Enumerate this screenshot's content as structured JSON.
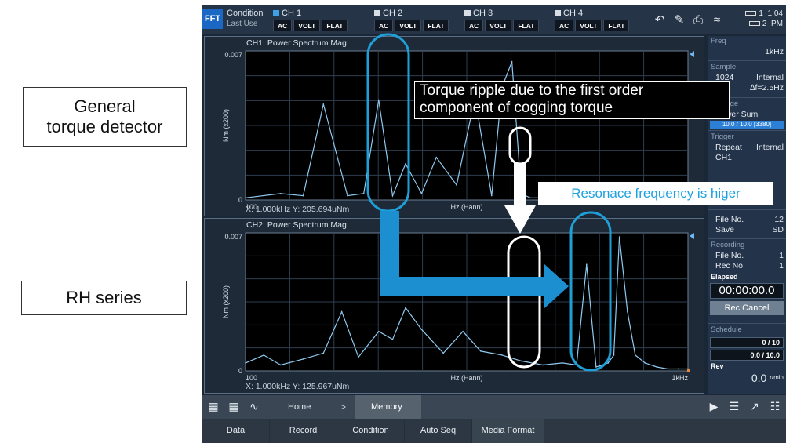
{
  "annotations": {
    "general_line1": "General",
    "general_line2": "torque detector",
    "rh_series": "RH series",
    "torque_line1": "Torque ripple due to the first order",
    "torque_line2": "component of cogging torque",
    "resonance": "Resonace frequency is higer"
  },
  "topbar": {
    "mode_badge": "FFT",
    "condition": "Condition",
    "last_use": "Last Use",
    "channels": [
      {
        "name": "CH 1",
        "coupling": "AC",
        "unit": "VOLT",
        "filter": "FLAT",
        "active": true
      },
      {
        "name": "CH 2",
        "coupling": "AC",
        "unit": "VOLT",
        "filter": "FLAT",
        "active": false
      },
      {
        "name": "CH 3",
        "coupling": "AC",
        "unit": "VOLT",
        "filter": "FLAT",
        "active": false
      },
      {
        "name": "CH 4",
        "coupling": "AC",
        "unit": "VOLT",
        "filter": "FLAT",
        "active": false
      }
    ],
    "battery1": "1",
    "battery2": "2",
    "time": "1:04",
    "ampm": "PM"
  },
  "right_panel": {
    "freq_head": "Freq",
    "freq_value": "1kHz",
    "sample_head": "Sample",
    "sample_count": "1024",
    "sample_src": "Internal",
    "sample_df": "∆f=2.5Hz",
    "average_head": "Average",
    "average_mode": "Power Sum",
    "average_progress": "10.0 / 10.0 [3380]",
    "trigger_head": "Trigger",
    "trigger_mode": "Repeat",
    "trigger_src": "Internal",
    "trigger_ch": "CH1",
    "file_label": "File No.",
    "file_value": "12",
    "save_label": "Save",
    "save_value": "SD",
    "recording_head": "Recording",
    "rec_file_label": "File No.",
    "rec_file_value": "1",
    "rec_no_label": "Rec No.",
    "rec_no_value": "1",
    "elapsed_label": "Elapsed",
    "elapsed_value": "00:00:00.0",
    "rec_cancel": "Rec Cancel",
    "schedule_head": "Schedule",
    "schedule_count": "0 / 10",
    "schedule_time": "0.0 / 10.0",
    "rev_label": "Rev",
    "rev_value": "0.0",
    "rev_unit": "r/min"
  },
  "nav": {
    "home": "Home",
    "chevron": ">",
    "memory": "Memory"
  },
  "function_bar": [
    "Data",
    "Record",
    "Condition",
    "Auto Seq",
    "Media Format"
  ],
  "colors": {
    "trace": "#8fc9f0",
    "circle_blue": "#1f9fd8",
    "circle_white": "#ffffff",
    "arrow_blue": "#1c8fd1",
    "plot_bg": "#000000",
    "grid": "#2e3e50"
  },
  "chart_data": [
    {
      "type": "line",
      "title": "CH1: Power Spectrum Mag",
      "xlabel": "Hz (Hann)",
      "ylabel": "Nm (x200)",
      "xlim_labels": [
        "100",
        ""
      ],
      "y_top_label": "0.007",
      "y_bottom_label": "0",
      "x_scale": "log",
      "xlim": [
        100,
        1000
      ],
      "ylim": [
        0,
        0.007
      ],
      "readout": "X: 1.000kHz Y: 205.694uNm",
      "x": [
        100,
        120,
        135,
        150,
        170,
        185,
        200,
        215,
        230,
        250,
        270,
        300,
        330,
        360,
        380,
        400,
        420,
        440,
        480,
        520,
        560,
        600,
        620,
        640,
        700,
        750,
        800,
        850,
        900,
        950,
        1000
      ],
      "y": [
        0.0001,
        0.0003,
        0.0002,
        0.0045,
        0.0002,
        0.0003,
        0.0047,
        0.0002,
        0.0017,
        0.0003,
        0.002,
        0.0007,
        0.0048,
        0.0002,
        0.0053,
        0.0065,
        0.0003,
        0.0001,
        0.0001,
        0.0001,
        0.0001,
        0.0001,
        0.0007,
        0.0001,
        0.0001,
        0.0001,
        0.0001,
        0.0001,
        0.0001,
        0.0001,
        0.0001
      ]
    },
    {
      "type": "line",
      "title": "CH2: Power Spectrum Mag",
      "xlabel": "Hz (Hann)",
      "ylabel": "Nm (x200)",
      "xlim_labels": [
        "100",
        "1kHz"
      ],
      "y_top_label": "0.007",
      "y_bottom_label": "0",
      "x_scale": "log",
      "xlim": [
        100,
        1000
      ],
      "ylim": [
        0,
        0.007
      ],
      "readout": "X: 1.000kHz Y: 125.967uNm",
      "x": [
        100,
        110,
        120,
        135,
        150,
        165,
        180,
        200,
        215,
        230,
        250,
        280,
        310,
        340,
        380,
        420,
        470,
        520,
        560,
        590,
        620,
        640,
        660,
        680,
        700,
        730,
        760,
        800,
        850,
        900,
        950,
        1000
      ],
      "y": [
        0.0004,
        0.0008,
        0.0003,
        0.0006,
        0.0009,
        0.003,
        0.0007,
        0.002,
        0.0016,
        0.0032,
        0.0021,
        0.0009,
        0.002,
        0.001,
        0.0008,
        0.0005,
        0.0003,
        0.0004,
        0.0003,
        0.0054,
        0.0002,
        0.0003,
        0.0004,
        0.0008,
        0.0068,
        0.003,
        0.0008,
        0.0004,
        0.0002,
        0.0001,
        0.0001,
        0.0001
      ]
    }
  ]
}
